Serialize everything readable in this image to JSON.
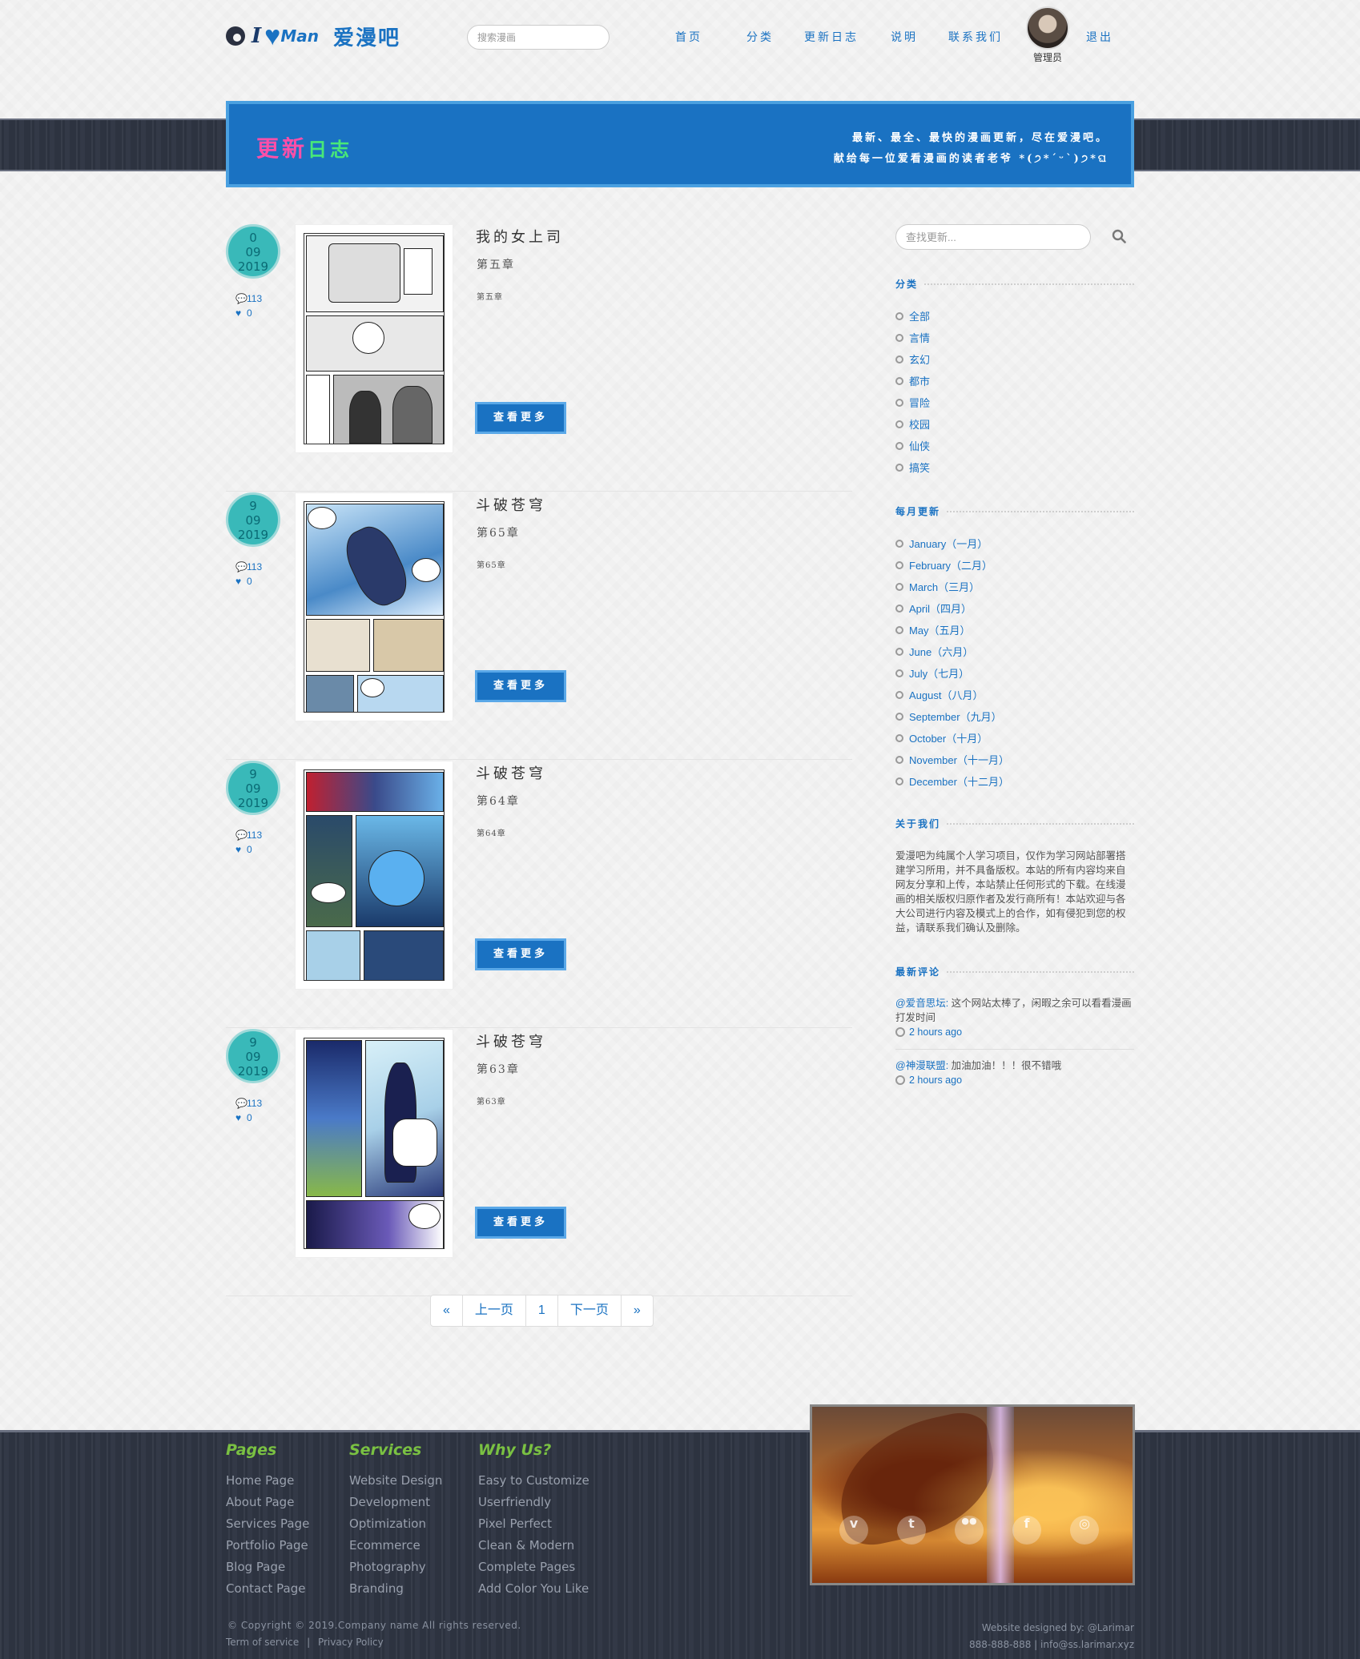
{
  "header": {
    "logo_i": "I",
    "logo_man": "Man",
    "logo_cn": "爱漫吧",
    "search_placeholder": "搜索漫画",
    "nav": [
      "首页",
      "分类",
      "更新日志",
      "说明",
      "联系我们",
      "退出"
    ],
    "user_label": "管理员"
  },
  "banner": {
    "title_part1": "更新",
    "title_part2": "日志",
    "line1": "最新、最全、最快的漫画更新，尽在爱漫吧。",
    "line2": "献给每一位爱看漫画的读者老爷 *(੭*ˊᵕˋ)੭*ଘ"
  },
  "posts": [
    {
      "date_day": "0",
      "date_month": "09",
      "date_year": "2019",
      "comments": "113",
      "likes": "0",
      "title": "我的女上司",
      "chapter": "第五章",
      "excerpt": "第五章",
      "button": "查看更多"
    },
    {
      "date_day": "9",
      "date_month": "09",
      "date_year": "2019",
      "comments": "113",
      "likes": "0",
      "title": "斗破苍穹",
      "chapter": "第65章",
      "excerpt": "第65章",
      "button": "查看更多"
    },
    {
      "date_day": "9",
      "date_month": "09",
      "date_year": "2019",
      "comments": "113",
      "likes": "0",
      "title": "斗破苍穹",
      "chapter": "第64章",
      "excerpt": "第64章",
      "button": "查看更多"
    },
    {
      "date_day": "9",
      "date_month": "09",
      "date_year": "2019",
      "comments": "113",
      "likes": "0",
      "title": "斗破苍穹",
      "chapter": "第63章",
      "excerpt": "第63章",
      "button": "查看更多"
    }
  ],
  "pagination": [
    "«",
    "上一页",
    "1",
    "下一页",
    "»"
  ],
  "sidebar": {
    "search_placeholder": "查找更新...",
    "categories_heading": "分类",
    "categories": [
      "全部",
      "言情",
      "玄幻",
      "都市",
      "冒险",
      "校园",
      "仙侠",
      "搞笑"
    ],
    "monthly_heading": "每月更新",
    "months": [
      "January（一月）",
      "February（二月）",
      "March（三月）",
      "April（四月）",
      "May（五月）",
      "June（六月）",
      "July（七月）",
      "August（八月）",
      "September（九月）",
      "October（十月）",
      "November（十一月）",
      "December（十二月）"
    ],
    "about_heading": "关于我们",
    "about_text": "爱漫吧为纯属个人学习项目，仅作为学习网站部署搭建学习所用，并不具备版权。本站的所有内容均来自网友分享和上传，本站禁止任何形式的下载。在线漫画的相关版权归原作者及发行商所有！本站欢迎与各大公司进行内容及模式上的合作，如有侵犯到您的权益，请联系我们确认及删除。",
    "comments_heading": "最新评论",
    "comments": [
      {
        "user": "@爱音思坛:",
        "text": " 这个网站太棒了，闲暇之余可以看看漫画打发时间",
        "time": "2 hours ago"
      },
      {
        "user": "@神漫联盟:",
        "text": " 加油加油！！！很不错哦",
        "time": "2 hours ago"
      }
    ]
  },
  "footer": {
    "col1": {
      "heading": "Pages",
      "items": [
        "Home Page",
        "About Page",
        "Services Page",
        "Portfolio Page",
        "Blog Page",
        "Contact Page"
      ]
    },
    "col2": {
      "heading": "Services",
      "items": [
        "Website Design",
        "Development",
        "Optimization",
        "Ecommerce",
        "Photography",
        "Branding"
      ]
    },
    "col3": {
      "heading": "Why Us?",
      "items": [
        "Easy to Customize",
        "Userfriendly",
        "Pixel Perfect",
        "Clean & Modern",
        "Complete Pages",
        "Add Color You Like"
      ]
    },
    "social": [
      "v",
      "t",
      "●●",
      "f",
      "◎"
    ],
    "copyright": "© Copyright © 2019.Company name All rights reserved.",
    "terms": "Term of service",
    "separator": "|",
    "privacy": "Privacy Policy",
    "designed_by": "Website designed by: @Larimar",
    "contact": "888-888-888 | info@ss.larimar.xyz"
  },
  "colors": {
    "primary": "#1a72c2",
    "teal": "#39b9b9",
    "footer_green": "#7ac142",
    "wood": "#2f3543"
  }
}
